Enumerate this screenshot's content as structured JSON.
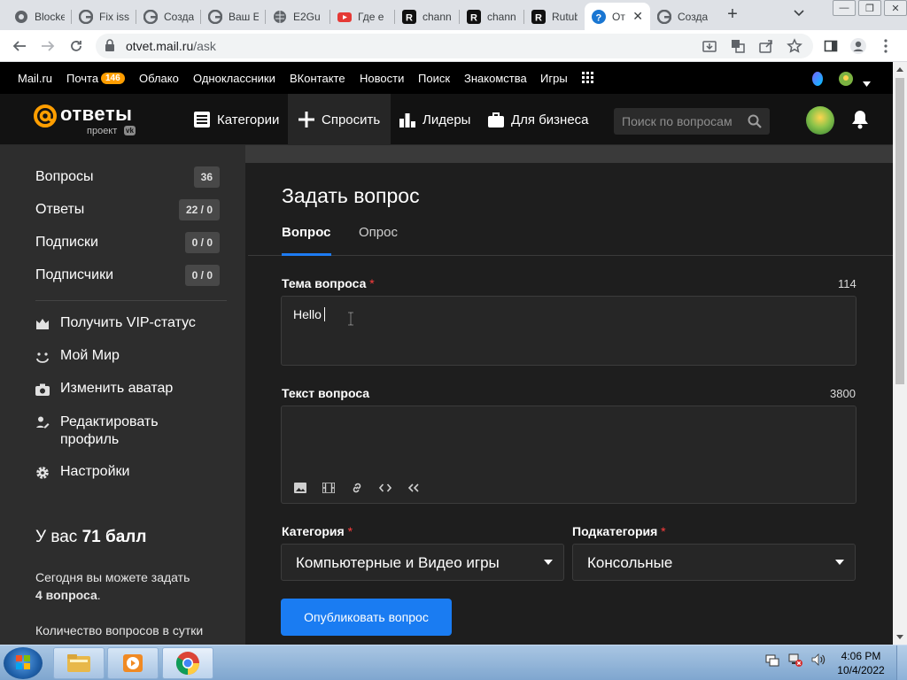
{
  "browser": {
    "tabs": [
      {
        "title": "Blocke",
        "icon": "chrome-icon"
      },
      {
        "title": "Fix iss",
        "icon": "google-icon"
      },
      {
        "title": "Созда",
        "icon": "google-icon"
      },
      {
        "title": "Ваш Е",
        "icon": "google-icon"
      },
      {
        "title": "E2Gu",
        "icon": "globe-icon"
      },
      {
        "title": "Где е",
        "icon": "youtube-icon"
      },
      {
        "title": "chann",
        "icon": "r-icon"
      },
      {
        "title": "chann",
        "icon": "r-icon"
      },
      {
        "title": "Rutub",
        "icon": "r-icon"
      },
      {
        "title": "От",
        "icon": "otvet-icon",
        "active": true
      },
      {
        "title": "Созда",
        "icon": "google-icon"
      }
    ],
    "url_host": "otvet.mail.ru",
    "url_path": "/ask"
  },
  "portal": {
    "links": [
      "Mail.ru",
      "Почта",
      "Облако",
      "Одноклассники",
      "ВКонтакте",
      "Новости",
      "Поиск",
      "Знакомства",
      "Игры"
    ],
    "mail_badge": "146"
  },
  "header": {
    "logo_name": "ответы",
    "logo_sub": "проект",
    "logo_vk": "vk",
    "nav": {
      "categories": "Категории",
      "ask": "Спросить",
      "leaders": "Лидеры",
      "business": "Для бизнеса"
    },
    "search_placeholder": "Поиск по вопросам"
  },
  "sidebar": {
    "stats": [
      {
        "label": "Вопросы",
        "count": "36"
      },
      {
        "label": "Ответы",
        "count": "22 / 0"
      },
      {
        "label": "Подписки",
        "count": "0 / 0"
      },
      {
        "label": "Подписчики",
        "count": "0 / 0"
      }
    ],
    "actions": [
      {
        "label": "Получить VIP-статус",
        "icon": "crown-icon"
      },
      {
        "label": "Мой Мир",
        "icon": "mymir-icon"
      },
      {
        "label": "Изменить аватар",
        "icon": "camera-icon"
      },
      {
        "label": "Редактировать\nпрофиль",
        "icon": "pencil-user-icon"
      },
      {
        "label": "Настройки",
        "icon": "gear-icon"
      }
    ],
    "points_prefix": "У вас",
    "points_value": "71 балл",
    "today_text": "Сегодня вы можете задать",
    "today_count": "4 вопроса",
    "today_suffix": ".",
    "daily_text": "Количество вопросов в сутки"
  },
  "main": {
    "title": "Задать вопрос",
    "tabs": [
      "Вопрос",
      "Опрос"
    ],
    "topic_label": "Тема вопроса",
    "topic_required": "*",
    "topic_count": "114",
    "topic_value": "Hello",
    "text_label": "Текст вопроса",
    "text_count": "3800",
    "editor_tools": [
      "image-icon",
      "video-icon",
      "link-icon",
      "code-icon",
      "quote-icon"
    ],
    "category_label": "Категория",
    "category_required": "*",
    "category_value": "Компьютерные и Видео игры",
    "subcategory_label": "Подкатегория",
    "subcategory_required": "*",
    "subcategory_value": "Консольные",
    "publish_label": "Опубликовать вопрос"
  },
  "taskbar": {
    "time": "4:06 PM",
    "date": "10/4/2022"
  }
}
